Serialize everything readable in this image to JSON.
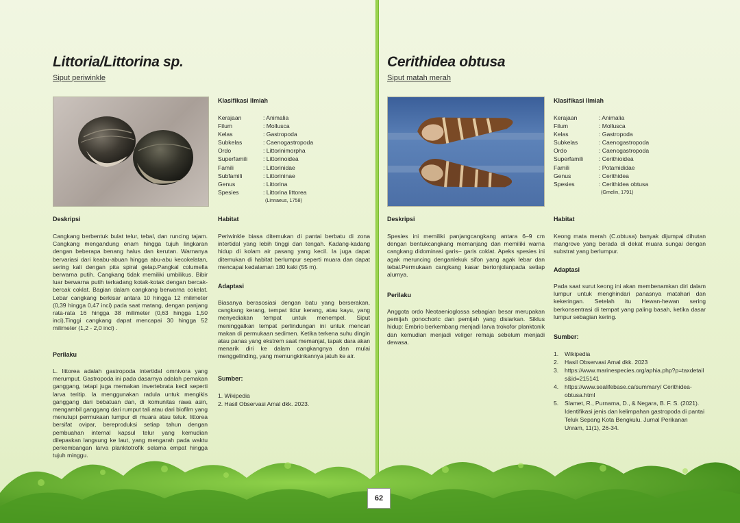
{
  "page_number": "62",
  "left": {
    "title": "Littoria/Littorina sp.",
    "subtitle": "Siput periwinkle",
    "klasifikasi_heading": "Klasifikasi Ilmiah",
    "klasifikasi": [
      {
        "k": "Kerajaan",
        "v": ": Animalia"
      },
      {
        "k": "Filum",
        "v": ": Mollusca"
      },
      {
        "k": "Kelas",
        "v": ": Gastropoda"
      },
      {
        "k": "Subkelas",
        "v": ": Caenogastropoda"
      },
      {
        "k": "Ordo",
        "v": ": Littorinimorpha"
      },
      {
        "k": "Superfamili",
        "v": ": Littorinoidea"
      },
      {
        "k": "Famili",
        "v": ": Littorinidae"
      },
      {
        "k": "Subfamili",
        "v": ": Littorininae"
      },
      {
        "k": "Genus",
        "v": ": Littorina"
      },
      {
        "k": "Spesies",
        "v": ": Littorina littorea"
      }
    ],
    "authority": "(Linnaeus, 1758)",
    "deskripsi_heading": "Deskripsi",
    "deskripsi": "Cangkang berbentuk bulat telur, tebal, dan runcing tajam. Cangkang mengandung enam hingga tujuh lingkaran dengan beberapa benang halus dan kerutan. Warnanya bervariasi dari keabu-abuan hingga abu-abu kecokelatan, sering kali dengan pita spiral gelap.Pangkal columella berwarna putih. Cangkang tidak memiliki umbilikus. Bibir luar berwarna putih terkadang kotak-kotak dengan bercak-bercak coklat. Bagian dalam cangkang berwarna cokelat. Lebar cangkang berkisar antara 10 hingga 12 milimeter (0,39 hingga 0,47 inci) pada saat matang, dengan panjang rata-rata 16 hingga 38 milimeter (0,63 hingga 1,50 inci),Tinggi cangkang dapat mencapai 30 hingga 52 milimeter (1,2 - 2,0 inci) .",
    "perilaku_heading": "Perilaku",
    "perilaku": "L. littorea adalah gastropoda intertidal omnivora yang merumput. Gastropoda ini pada dasarnya adalah pemakan ganggang, tetapi juga memakan invertebrata kecil seperti larva teritip. Ia menggunakan radula untuk mengikis ganggang dari bebatuan dan, di komunitas rawa asin, mengambil ganggang dari rumput tali atau dari biofilm yang menutupi permukaan lumpur di muara atau teluk. littorea bersifat ovipar, bereproduksi setiap tahun dengan pembuahan internal kapsul telur yang kemudian dilepaskan langsung ke laut, yang mengarah pada waktu perkembangan larva planktotrofik selama empat hingga tujuh minggu.",
    "habitat_heading": "Habitat",
    "habitat": "Periwinkle biasa ditemukan di pantai berbatu di zona intertidal yang lebih tinggi dan tengah. Kadang-kadang hidup di kolam air pasang yang kecil. Ia juga dapat ditemukan di habitat berlumpur seperti muara dan dapat mencapai kedalaman 180 kaki (55 m).",
    "adaptasi_heading": "Adaptasi",
    "adaptasi": "Biasanya berasosiasi dengan batu yang berserakan, cangkang kerang, tempat tidur kerang, atau kayu, yang menyediakan tempat untuk menempel. Siput meninggalkan tempat perlindungan ini untuk mencari makan di permukaan sedimen. Ketika terkena suhu dingin atau panas yang ekstrem saat memanjat, tapak dara akan menarik diri ke dalam cangkangnya dan mulai menggelinding, yang memungkinkannya jatuh ke air.",
    "sumber_heading": "Sumber:",
    "sumber": [
      "1. Wikipedia",
      "2. Hasil Observasi Amal dkk. 2023."
    ]
  },
  "right": {
    "title": "Cerithidea obtusa",
    "subtitle": "Siput matah merah",
    "klasifikasi_heading": "Klasifikasi Ilmiah",
    "klasifikasi": [
      {
        "k": "Kerajaan",
        "v": ": Animalia"
      },
      {
        "k": "Filum",
        "v": ": Mollusca"
      },
      {
        "k": "Kelas",
        "v": ": Gastropoda"
      },
      {
        "k": "Subkelas",
        "v": ": Caenogastropoda"
      },
      {
        "k": "Ordo",
        "v": ": Caenogastropoda"
      },
      {
        "k": "Superfamili",
        "v": ": Cerithioidea"
      },
      {
        "k": "Famili",
        "v": ": Potamididae"
      },
      {
        "k": "Genus",
        "v": ": Cerithidea"
      },
      {
        "k": "Spesies",
        "v": ": Cerithidea obtusa"
      }
    ],
    "authority": "(Gmelin, 1791)",
    "deskripsi_heading": "Deskripsi",
    "deskripsi": "Spesies ini memiliki panjangcangkang antara 6–9 cm dengan bentukcangkang memanjang dan memiliki warna cangkang didominasi garis– garis coklat. Apeks spesies ini agak meruncing denganlekuk sifon yang agak lebar dan tebal.Permukaan cangkang kasar bertonjolanpada setiap alurnya.",
    "perilaku_heading": "Perilaku",
    "perilaku": "Anggota ordo Neotaenioglossa sebagian besar merupakan pemijah gonochoric dan pemijah yang disiarkan. Siklus hidup: Embrio berkembang menjadi larva trokofor planktonik dan kemudian menjadi veliger remaja sebelum menjadi dewasa.",
    "habitat_heading": "Habitat",
    "habitat": "Keong mata merah (C.obtusa) banyak dijumpai dihutan mangrove yang berada di dekat muara sungai dengan substrat yang berlumpur.",
    "adaptasi_heading": "Adaptasi",
    "adaptasi": "Pada saat surut keong ini akan membenamkan diri dalam lumpur untuk menghindari panasnya matahari dan kekeringan. Setelah itu Hewan-hewan sering berkonsentrasi di tempat yang paling basah, ketika dasar lumpur sebagian kering.",
    "sumber_heading": "Sumber:",
    "sumber": [
      {
        "n": "1.",
        "t": "Wikipedia"
      },
      {
        "n": "2.",
        "t": "Hasil Observasi Amal dkk. 2023"
      },
      {
        "n": "3.",
        "t": "https://www.marinespecies.org/aphia.php?p=taxdetails&id=215141"
      },
      {
        "n": "4.",
        "t": "https://www.sealifebase.ca/summary/ Cerithidea-obtusa.html"
      },
      {
        "n": "5.",
        "t": "Slamet, R., Purnama, D., & Negara, B. F. S. (2021). Identifikasi jenis dan kelimpahan gastropoda di pantai Teluk Sepang Kota Bengkulu. Jurnal Perikanan Unram, 11(1), 26-34."
      }
    ]
  }
}
